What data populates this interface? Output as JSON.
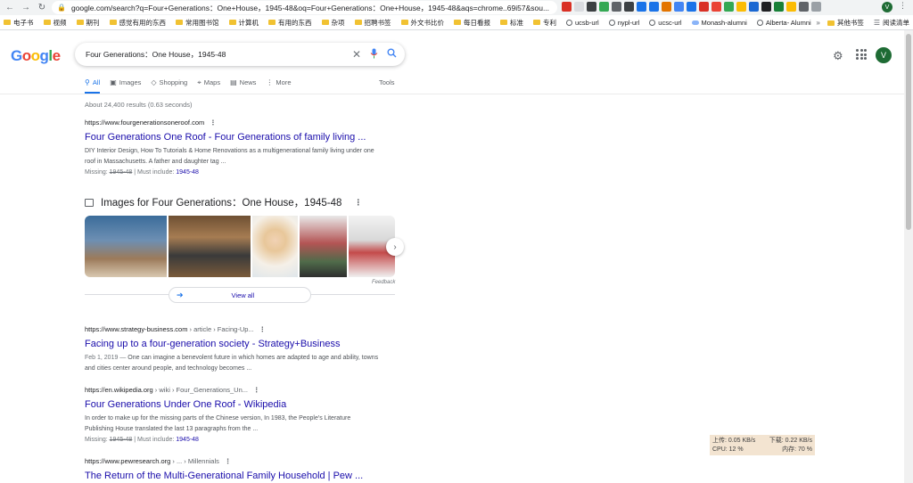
{
  "browser": {
    "url": "google.com/search?q=Four+Generations：One+House，1945-48&oq=Four+Generations：One+House，1945-48&aqs=chrome..69i57&sou...",
    "profile_initial": "V",
    "bookmarks": [
      {
        "label": "电子书",
        "icon": "folder-icon"
      },
      {
        "label": "视频",
        "icon": "folder-icon"
      },
      {
        "label": "期刊",
        "icon": "folder-icon"
      },
      {
        "label": "感觉有用的东西",
        "icon": "folder-icon"
      },
      {
        "label": "常用图书馆",
        "icon": "folder-icon"
      },
      {
        "label": "计算机",
        "icon": "folder-icon"
      },
      {
        "label": "有用的东西",
        "icon": "folder-icon"
      },
      {
        "label": "杂项",
        "icon": "folder-icon"
      },
      {
        "label": "招聘书签",
        "icon": "folder-icon"
      },
      {
        "label": "外文书比价",
        "icon": "folder-icon"
      },
      {
        "label": "每日看报",
        "icon": "folder-icon"
      },
      {
        "label": "标准",
        "icon": "folder-icon"
      },
      {
        "label": "专利",
        "icon": "folder-icon"
      },
      {
        "label": "ucsb-url",
        "icon": "globe-icon"
      },
      {
        "label": "nypl-url",
        "icon": "globe-icon"
      },
      {
        "label": "ucsc-url",
        "icon": "globe-icon"
      },
      {
        "label": "Monash-alumni",
        "icon": "cloud-icon"
      },
      {
        "label": "Alberta- Alumni",
        "icon": "globe-icon"
      }
    ],
    "bookmarks_more": "»",
    "other_bookmarks": "其他书签",
    "reading_list": "阅读清单"
  },
  "search": {
    "query": "Four Generations：One House，1945-48",
    "stats": "About 24,400 results (0.63 seconds)"
  },
  "tabs": [
    {
      "label": "All",
      "icon": "search-icon"
    },
    {
      "label": "Images",
      "icon": "image-icon"
    },
    {
      "label": "Shopping",
      "icon": "tag-icon"
    },
    {
      "label": "Maps",
      "icon": "pin-icon"
    },
    {
      "label": "News",
      "icon": "news-icon"
    },
    {
      "label": "More",
      "icon": "more-icon"
    }
  ],
  "tools_label": "Tools",
  "results": [
    {
      "url": "https://www.fourgenerationsoneroof.com",
      "crumbs": "",
      "title": "Four Generations One Roof - Four Generations of family living ...",
      "date": "",
      "snippet": "DIY Interior Design, How To Tutorials & Home Renovations as a multigenerational family living under one roof in Massachusetts. A father and daughter tag ...",
      "missing_label": "Missing:",
      "missing_term": "1945-48",
      "must_include_label": "| Must include:",
      "must_include_term": "1945-48"
    },
    {
      "url": "https://www.strategy-business.com",
      "crumbs": " › article › Facing-Up...",
      "title": "Facing up to a four-generation society - Strategy+Business",
      "date": "Feb 1, 2019 — ",
      "snippet": "One can imagine a benevolent future in which homes are adapted to age and ability, towns and cities center around people, and technology becomes ...",
      "missing_label": "",
      "missing_term": "",
      "must_include_label": "",
      "must_include_term": ""
    },
    {
      "url": "https://en.wikipedia.org",
      "crumbs": " › wiki › Four_Generations_Un...",
      "title": "Four Generations Under One Roof - Wikipedia",
      "date": "",
      "snippet": "In order to make up for the missing parts of the Chinese version, In 1983, the People's Literature Publishing House translated the last 13 paragraphs from the ...",
      "missing_label": "Missing:",
      "missing_term": "1945-48",
      "must_include_label": "| Must include:",
      "must_include_term": "1945-48"
    },
    {
      "url": "https://www.pewresearch.org",
      "crumbs": " › ... › Millennials",
      "title": "The Return of the Multi-Generational Family Household | Pew ...",
      "date": "",
      "snippet": "",
      "missing_label": "",
      "missing_term": "",
      "must_include_label": "",
      "must_include_term": ""
    }
  ],
  "images_block": {
    "heading": "Images for Four Generations：One House，1945-48",
    "feedback": "Feedback",
    "view_all": "View all"
  },
  "system_monitor": {
    "upload": "上传: 0.05 KB/s",
    "download": "下载: 0.22 KB/s",
    "cpu": "CPU: 12 %",
    "memory": "内存: 70 %"
  },
  "colors": {
    "link": "#1a0dab",
    "accent": "#1a73e8",
    "avatar_bg": "#1e6b34"
  }
}
